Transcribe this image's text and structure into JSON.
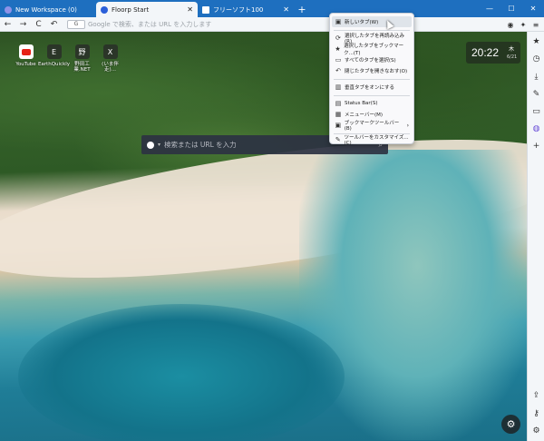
{
  "tabs": [
    {
      "label": "New Workspace (0)",
      "icon": "workspace-icon",
      "color": "#6b6fd8"
    },
    {
      "label": "Floorp Start",
      "icon": "floorp-icon",
      "color": "#2b5fd9",
      "active": true
    },
    {
      "label": "フリーソフト100",
      "icon": "page-icon",
      "color": "#ffffff"
    }
  ],
  "window_controls": {
    "minimize": "—",
    "maximize": "☐",
    "close": "✕"
  },
  "tab_close": "✕",
  "new_tab": "+",
  "nav": {
    "back": "←",
    "forward": "→",
    "reload": "C",
    "undo": "↶",
    "engine": "G",
    "url_placeholder": "Google で検索、または URL を入力します"
  },
  "shortcuts": [
    {
      "label": "YouTube",
      "icon": "youtube-icon",
      "glyph": ""
    },
    {
      "label": "EarthQuickly",
      "icon": "letter-e-icon",
      "glyph": "E"
    },
    {
      "label": "野田工業.NET",
      "icon": "kanji-icon",
      "glyph": "野"
    },
    {
      "label": "(いま伴走)...",
      "icon": "x-icon",
      "glyph": "X"
    }
  ],
  "clock": {
    "time": "20:22",
    "day": "木",
    "date": "6/21"
  },
  "search": {
    "placeholder": "検索または URL を入力",
    "icon": "⌕"
  },
  "menu": [
    {
      "label": "新しいタブ(W)",
      "icon": "new-tab-icon",
      "glyph": "▣",
      "hover": true
    },
    {
      "label": "選択したタブを再読み込み(R)",
      "icon": "reload-icon",
      "glyph": "⟳"
    },
    {
      "label": "選択したタブをブックマーク...(T)",
      "icon": "star-icon",
      "glyph": "★"
    },
    {
      "label": "すべてのタブを選択(S)",
      "icon": "select-all-icon",
      "glyph": "▭"
    },
    {
      "label": "閉じたタブを開きなおす(O)",
      "icon": "undo-icon",
      "glyph": "↶"
    },
    {
      "label": "垂直タブをオンにする",
      "icon": "vertical-tabs-icon",
      "glyph": "▥"
    },
    {
      "label": "Status Bar(S)",
      "icon": "status-bar-icon",
      "glyph": "▤"
    },
    {
      "label": "メニューバー(M)",
      "icon": "menubar-icon",
      "glyph": "▦"
    },
    {
      "label": "ブックマークツールバー(B)",
      "icon": "bookmark-toolbar-icon",
      "glyph": "▣",
      "arrow": "›"
    },
    {
      "label": "ツールバーをカスタマイズ...(C)",
      "icon": "customize-icon",
      "glyph": "✎"
    }
  ],
  "settings_fab": "⚙"
}
